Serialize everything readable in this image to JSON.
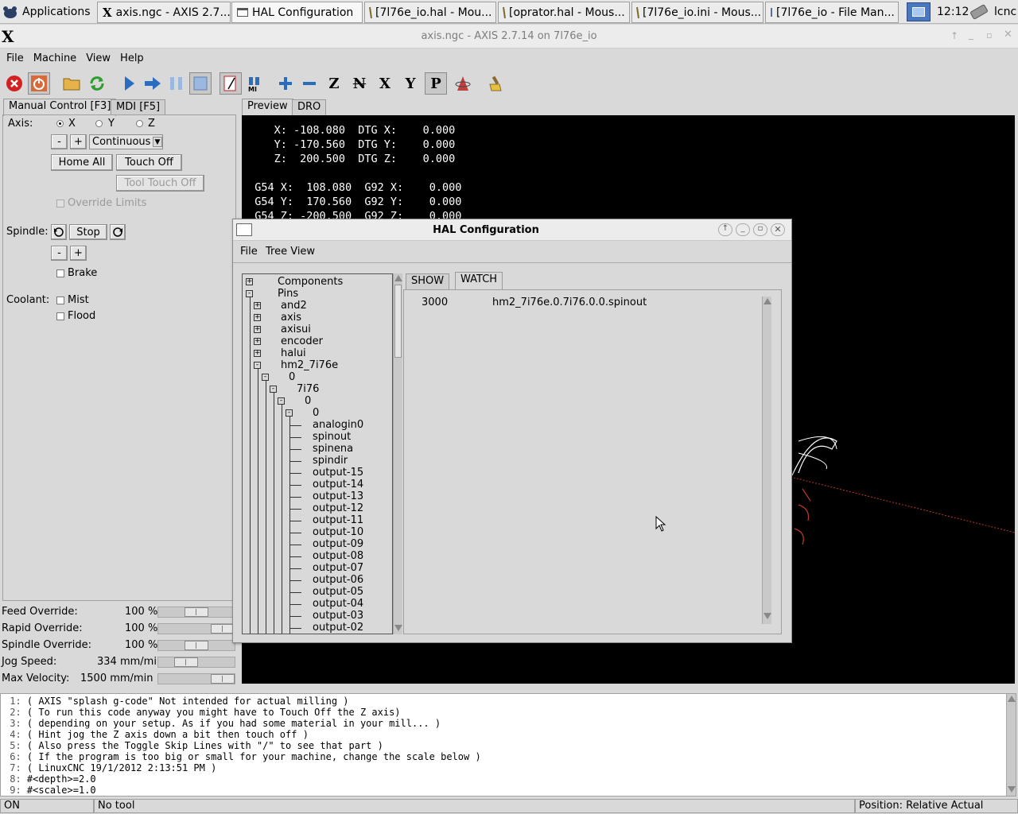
{
  "taskbar": {
    "apps_label": "Applications",
    "tasks": [
      {
        "label": "axis.ngc - AXIS 2.7....",
        "icon": "x-icon"
      },
      {
        "label": "HAL Configuration",
        "icon": "window-icon",
        "active": true
      },
      {
        "label": "[7l76e_io.hal - Mou...",
        "icon": "text-editor-icon"
      },
      {
        "label": "[oprator.hal - Mous...",
        "icon": "text-editor-icon"
      },
      {
        "label": "[7l76e_io.ini - Mous...",
        "icon": "text-editor-icon"
      },
      {
        "label": "[7l76e_io - File Man...",
        "icon": "folder-icon"
      }
    ],
    "clock": "12:12",
    "user": "lcnc"
  },
  "window": {
    "title": "axis.ngc - AXIS 2.7.14 on 7l76e_io",
    "menu": [
      "File",
      "Machine",
      "View",
      "Help"
    ]
  },
  "toolbar": {
    "icons": [
      "estop-icon",
      "power-icon",
      "open-file-icon",
      "reload-icon",
      "run-icon",
      "step-icon",
      "pause-icon",
      "stop-icon",
      "block-delete-icon",
      "optional-stop-icon",
      "zoom-in-icon",
      "zoom-out-icon",
      "view-z-icon",
      "view-z2-icon",
      "view-x-icon",
      "view-y-icon",
      "view-p-icon",
      "rotate-icon",
      "clear-plot-icon"
    ],
    "text_glyphs": {
      "view_z": "Z",
      "view_x": "X",
      "view_y": "Y",
      "view_p": "P",
      "mdi": "MI"
    }
  },
  "left": {
    "tabs": [
      "Manual Control [F3]",
      "MDI [F5]"
    ],
    "axis_label": "Axis:",
    "axes": [
      "X",
      "Y",
      "Z"
    ],
    "selected_axis": "X",
    "jog_minus": "-",
    "jog_plus": "+",
    "jog_mode": "Continuous",
    "home_all": "Home All",
    "touch_off": "Touch Off",
    "tool_touch_off": "Tool Touch Off",
    "override_limits": "Override Limits",
    "spindle_label": "Spindle:",
    "spindle_stop": "Stop",
    "spindle_minus": "-",
    "spindle_plus": "+",
    "brake": "Brake",
    "coolant_label": "Coolant:",
    "mist": "Mist",
    "flood": "Flood"
  },
  "sliders": [
    {
      "label": "Feed Override:",
      "value": "100 %",
      "fraction": 0.5
    },
    {
      "label": "Rapid Override:",
      "value": "100 %",
      "fraction": 1.0
    },
    {
      "label": "Spindle Override:",
      "value": "100 %",
      "fraction": 0.5
    },
    {
      "label": "Jog Speed:",
      "value": "334 mm/min",
      "fraction": 0.3
    },
    {
      "label": "Max Velocity:",
      "value": "1500 mm/min",
      "fraction": 1.0
    }
  ],
  "preview": {
    "tabs": [
      "Preview",
      "DRO"
    ],
    "dro_lines": [
      "     X: -108.080  DTG X:    0.000",
      "     Y: -170.560  DTG Y:    0.000",
      "     Z:  200.500  DTG Z:    0.000",
      "",
      "  G54 X:  108.080  G92 X:    0.000",
      "  G54 Y:  170.560  G92 Y:    0.000",
      "  G54 Z: -200.500  G92 Z:    0.000"
    ]
  },
  "hal": {
    "title": "HAL Configuration",
    "menu": [
      "File",
      "Tree View"
    ],
    "tabs": [
      "SHOW",
      "WATCH"
    ],
    "selected_tab": "WATCH",
    "watch": [
      {
        "value": "3000",
        "name": "hm2_7i76e.0.7i76.0.0.spinout"
      }
    ],
    "tree": [
      {
        "label": "Components",
        "level": 0,
        "toggle": "+"
      },
      {
        "label": "Pins",
        "level": 0,
        "toggle": "-"
      },
      {
        "label": "and2",
        "level": 1,
        "toggle": "+"
      },
      {
        "label": "axis",
        "level": 1,
        "toggle": "+"
      },
      {
        "label": "axisui",
        "level": 1,
        "toggle": "+"
      },
      {
        "label": "encoder",
        "level": 1,
        "toggle": "+"
      },
      {
        "label": "halui",
        "level": 1,
        "toggle": "+"
      },
      {
        "label": "hm2_7i76e",
        "level": 1,
        "toggle": "-"
      },
      {
        "label": "0",
        "level": 2,
        "toggle": "-"
      },
      {
        "label": "7i76",
        "level": 3,
        "toggle": "-"
      },
      {
        "label": "0",
        "level": 4,
        "toggle": "-"
      },
      {
        "label": "0",
        "level": 5,
        "toggle": "-"
      },
      {
        "label": "analogin0",
        "level": 6
      },
      {
        "label": "spinout",
        "level": 6
      },
      {
        "label": "spinena",
        "level": 6
      },
      {
        "label": "spindir",
        "level": 6
      },
      {
        "label": "output-15",
        "level": 6
      },
      {
        "label": "output-14",
        "level": 6
      },
      {
        "label": "output-13",
        "level": 6
      },
      {
        "label": "output-12",
        "level": 6
      },
      {
        "label": "output-11",
        "level": 6
      },
      {
        "label": "output-10",
        "level": 6
      },
      {
        "label": "output-09",
        "level": 6
      },
      {
        "label": "output-08",
        "level": 6
      },
      {
        "label": "output-07",
        "level": 6
      },
      {
        "label": "output-06",
        "level": 6
      },
      {
        "label": "output-05",
        "level": 6
      },
      {
        "label": "output-04",
        "level": 6
      },
      {
        "label": "output-03",
        "level": 6
      },
      {
        "label": "output-02",
        "level": 6
      }
    ]
  },
  "code": [
    {
      "n": " 1:",
      "t": "( AXIS \"splash g-code\" Not intended for actual milling )"
    },
    {
      "n": " 2:",
      "t": "( To run this code anyway you might have to Touch Off the Z axis)"
    },
    {
      "n": " 3:",
      "t": "( depending on your setup. As if you had some material in your mill... )"
    },
    {
      "n": " 4:",
      "t": "( Hint jog the Z axis down a bit then touch off )"
    },
    {
      "n": " 5:",
      "t": "( Also press the Toggle Skip Lines with \"/\" to see that part )"
    },
    {
      "n": " 6:",
      "t": "( If the program is too big or small for your machine, change the scale below )"
    },
    {
      "n": " 7:",
      "t": "( LinuxCNC 19/1/2012 2:13:51 PM )"
    },
    {
      "n": " 8:",
      "t": "#<depth>=2.0"
    },
    {
      "n": " 9:",
      "t": "#<scale>=1.0"
    }
  ],
  "status": {
    "state": "ON",
    "tool": "No tool",
    "position": "Position: Relative Actual"
  },
  "colors": {
    "preview_bg": "#000000",
    "dro_text": "#ffffff",
    "plot_red": "#c0392b",
    "estop_red": "#d32020",
    "run_blue": "#2a6cc0"
  }
}
